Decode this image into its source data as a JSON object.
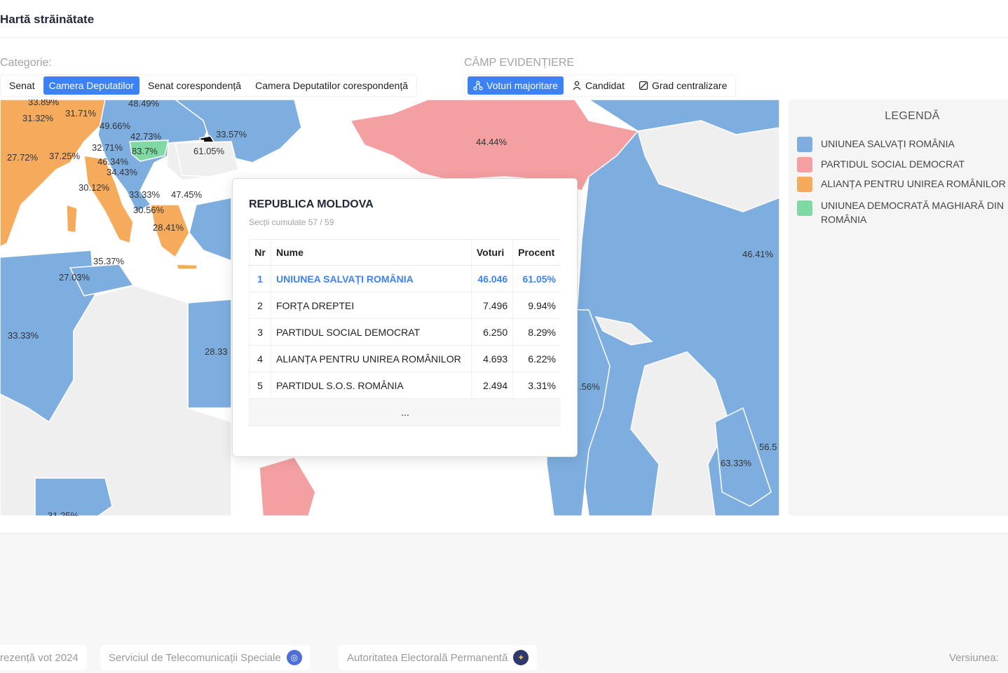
{
  "header": {
    "title": "Hartă străinătate"
  },
  "category": {
    "label": "Categorie:",
    "tabs": [
      {
        "label": "Senat",
        "active": false
      },
      {
        "label": "Camera Deputatilor",
        "active": true
      },
      {
        "label": "Senat corespondență",
        "active": false
      },
      {
        "label": "Camera Deputatilor corespondență",
        "active": false
      }
    ]
  },
  "highlight": {
    "label": "CÂMP EVIDENȚIERE",
    "tabs": [
      {
        "label": "Voturi majoritare",
        "icon": "network-icon",
        "active": true
      },
      {
        "label": "Candidat",
        "icon": "person-icon",
        "active": false
      },
      {
        "label": "Grad centralizare",
        "icon": "pie-icon",
        "active": false
      }
    ]
  },
  "colors": {
    "usr": "#7eaee0",
    "psd": "#f4a0a2",
    "aur": "#f6ab5c",
    "udmr": "#7fd9a3",
    "neutral": "#efefef",
    "accent": "#3b82f6"
  },
  "map_labels": {
    "l1": "33.89%",
    "l2": "31.71%",
    "l3": "48.49%",
    "l4": "31.32%",
    "l5": "49.66%",
    "l6": "42.73%",
    "l7": "33.57%",
    "l8": "27.72%",
    "l9": "37.25%",
    "l10": "32.71%",
    "l11": "83.7%",
    "l12": "61.05%",
    "l13": "46.34%",
    "l14": "34.43%",
    "l15": "30.12%",
    "l16": "33.33%",
    "l17": "47.45%",
    "l18": "30.56%",
    "l19": "28.41%",
    "l20": "35.37%",
    "l21": "27.03%",
    "l22": "33.33%",
    "l23": "28.33",
    "l24": "44.44%",
    "l25": "46.41%",
    "l26": ".56%",
    "l27": "56.5",
    "l28": "63.33%",
    "l29": "31.25%"
  },
  "legend": {
    "title": "LEGENDĂ",
    "items": [
      {
        "label": "UNIUNEA SALVAȚI ROMÂNIA",
        "color": "#7eaee0"
      },
      {
        "label": "PARTIDUL SOCIAL DEMOCRAT",
        "color": "#f4a0a2"
      },
      {
        "label": "ALIANȚA PENTRU UNIREA ROMÂNILOR",
        "color": "#f6ab5c"
      },
      {
        "label": "UNIUNEA DEMOCRATĂ MAGHIARĂ DIN ROMÂNIA",
        "color": "#7fd9a3"
      }
    ]
  },
  "tooltip": {
    "title": "REPUBLICA MOLDOVA",
    "subtitle": "Secții cumulate 57 / 59",
    "columns": {
      "nr": "Nr",
      "name": "Nume",
      "votes": "Voturi",
      "percent": "Procent"
    },
    "rows": [
      {
        "nr": "1",
        "name": "UNIUNEA SALVAȚI ROMÂNIA",
        "votes": "46.046",
        "percent": "61.05%"
      },
      {
        "nr": "2",
        "name": "FORȚA DREPTEI",
        "votes": "7.496",
        "percent": "9.94%"
      },
      {
        "nr": "3",
        "name": "PARTIDUL SOCIAL DEMOCRAT",
        "votes": "6.250",
        "percent": "8.29%"
      },
      {
        "nr": "4",
        "name": "ALIANȚA PENTRU UNIREA ROMÂNILOR",
        "votes": "4.693",
        "percent": "6.22%"
      },
      {
        "nr": "5",
        "name": "PARTIDUL S.O.S. ROMÂNIA",
        "votes": "2.494",
        "percent": "3.31%"
      }
    ],
    "more": "..."
  },
  "footer": {
    "link1": "rezență vot 2024",
    "link2": "Serviciul de Telecomunicații Speciale",
    "link3": "Autoritatea Electorală Permanentă",
    "version": "Versiunea: "
  }
}
